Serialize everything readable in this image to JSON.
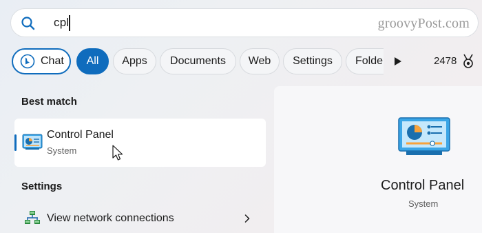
{
  "search": {
    "query": "cpl",
    "watermark": "groovyPost.com"
  },
  "filters": {
    "chips": [
      {
        "label": "Chat",
        "active": false
      },
      {
        "label": "All",
        "active": true
      },
      {
        "label": "Apps",
        "active": false
      },
      {
        "label": "Documents",
        "active": false
      },
      {
        "label": "Web",
        "active": false
      },
      {
        "label": "Settings",
        "active": false
      },
      {
        "label": "Folde",
        "active": false
      }
    ],
    "points": "2478"
  },
  "results": {
    "best_match_label": "Best match",
    "best_match": {
      "title": "Control Panel",
      "subtitle": "System",
      "icon": "control-panel-icon"
    },
    "settings_label": "Settings",
    "settings_items": [
      {
        "label": "View network connections",
        "icon": "network-icon"
      }
    ]
  },
  "preview": {
    "title": "Control Panel",
    "subtitle": "System",
    "icon": "control-panel-icon"
  },
  "colors": {
    "accent": "#0f6cbd",
    "icon_blue": "#3aa5e6",
    "icon_orange": "#f7a23b"
  }
}
